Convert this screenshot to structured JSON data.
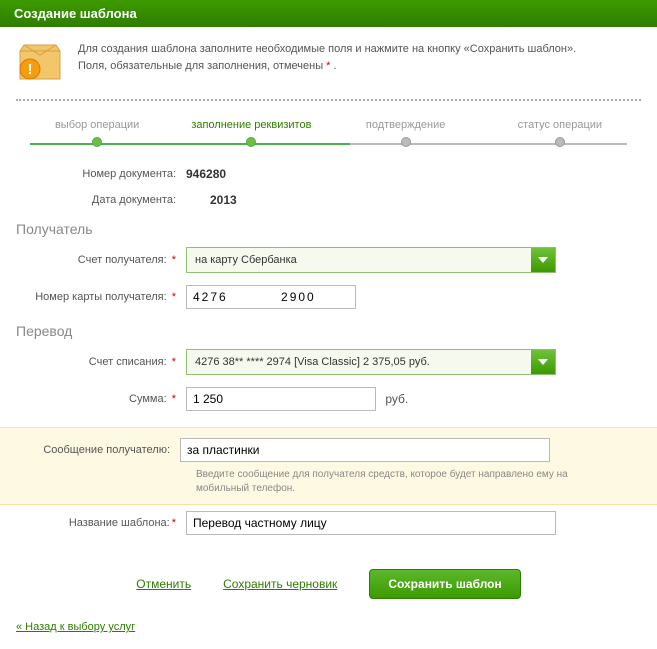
{
  "header": {
    "title": "Создание шаблона"
  },
  "info": {
    "line1": "Для создания шаблона заполните необходимые поля и нажмите на кнопку «Сохранить шаблон».",
    "line2_before": "Поля, обязательные для заполнения, отмечены ",
    "line2_after": " ."
  },
  "wizard": {
    "steps": [
      "выбор операции",
      "заполнение реквизитов",
      "подтверждение",
      "статус операции"
    ]
  },
  "fields": {
    "doc_number_label": "Номер документа:",
    "doc_number": "946280",
    "doc_date_label": "Дата документа:",
    "doc_date": "2013",
    "section_recipient": "Получатель",
    "recipient_account_label": "Счет получателя:",
    "recipient_account_value": "на карту Сбербанка",
    "recipient_card_label": "Номер карты получателя:",
    "recipient_card_value": "4276          2900",
    "section_transfer": "Перевод",
    "debit_account_label": "Счет списания:",
    "debit_account_value": "4276 38** **** 2974  [Visa Classic] 2 375,05  руб.",
    "amount_label": "Сумма:",
    "amount_value": "1 250",
    "amount_unit": "руб.",
    "message_label": "Сообщение получателю:",
    "message_value": "за пластинки",
    "message_hint": "Введите сообщение для получателя средств, которое будет направлено ему на мобильный телефон.",
    "template_name_label": "Название шаблона:",
    "template_name_value": "Перевод частному лицу"
  },
  "actions": {
    "cancel": "Отменить",
    "save_draft": "Сохранить черновик",
    "save_template": "Сохранить шаблон"
  },
  "back_link": "« Назад к выбору услуг"
}
